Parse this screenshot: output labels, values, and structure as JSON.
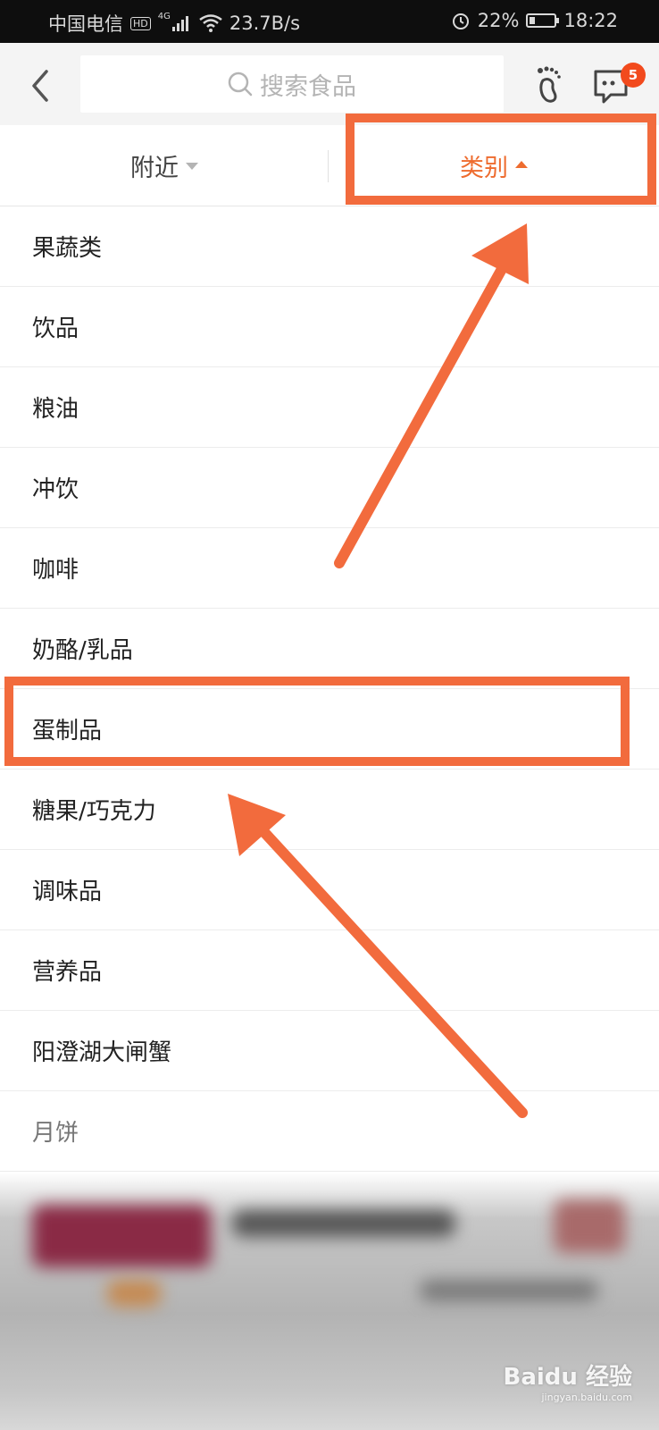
{
  "status_bar": {
    "carrier": "中国电信",
    "hd": "HD",
    "network": "4G",
    "speed": "23.7B/s",
    "battery": "22%",
    "battery_level": 0.22,
    "time": "18:22"
  },
  "header": {
    "search_placeholder": "搜索食品",
    "message_badge": "5"
  },
  "tabs": {
    "nearby": "附近",
    "category": "类别",
    "active": "category"
  },
  "categories": [
    "果蔬类",
    "饮品",
    "粮油",
    "冲饮",
    "咖啡",
    "奶酪/乳品",
    "蛋制品",
    "糖果/巧克力",
    "调味品",
    "营养品",
    "阳澄湖大闸蟹",
    "月饼"
  ],
  "annotation": {
    "color": "#f26b3d",
    "highlighted_item": "蛋制品"
  },
  "watermark": {
    "brand": "Baidu",
    "label": "经验",
    "url": "jingyan.baidu.com"
  }
}
